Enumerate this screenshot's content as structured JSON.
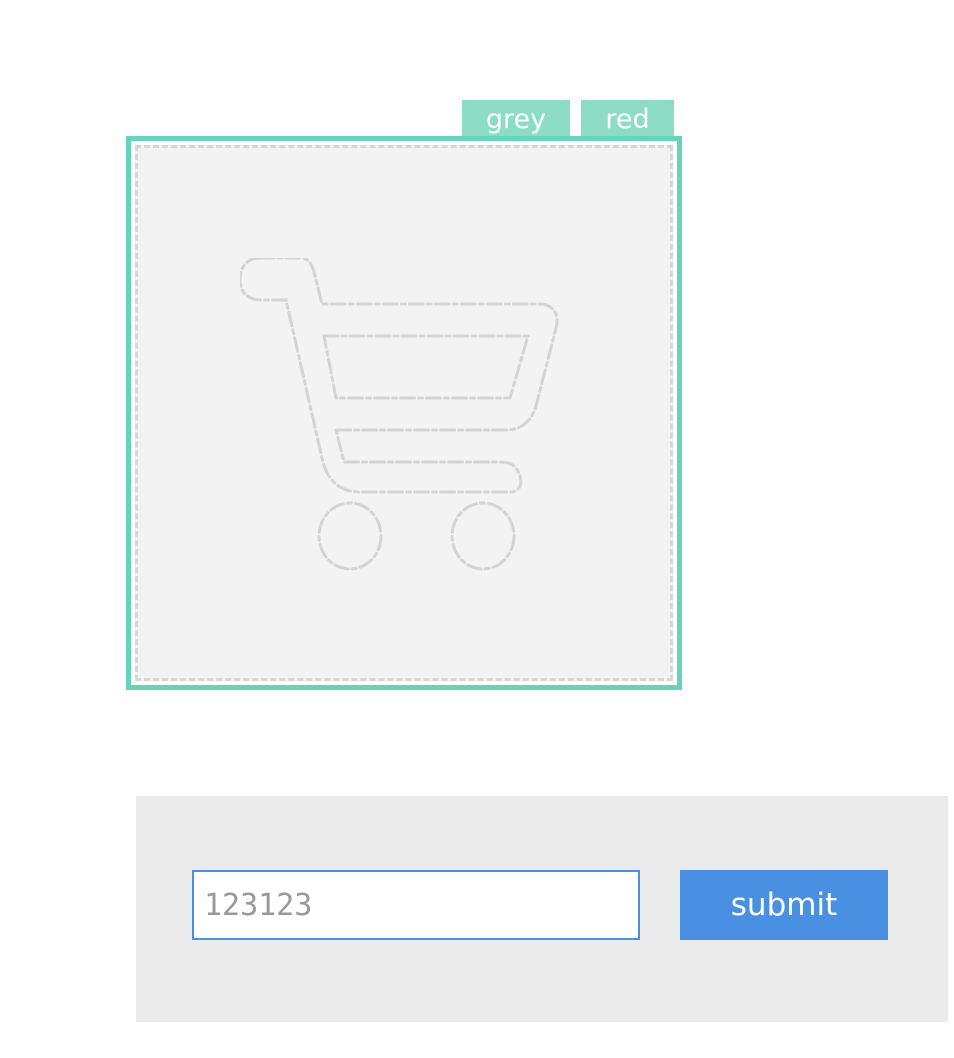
{
  "tabs": {
    "grey_label": "grey",
    "red_label": "red"
  },
  "preview": {
    "icon": "shopping-cart-icon",
    "frame_color": "#66d4bc",
    "tab_color": "#8cdcc6",
    "canvas_color": "#f3f3f3"
  },
  "form": {
    "input_value": "123123",
    "submit_label": "submit",
    "accent_color": "#4a90e2"
  }
}
